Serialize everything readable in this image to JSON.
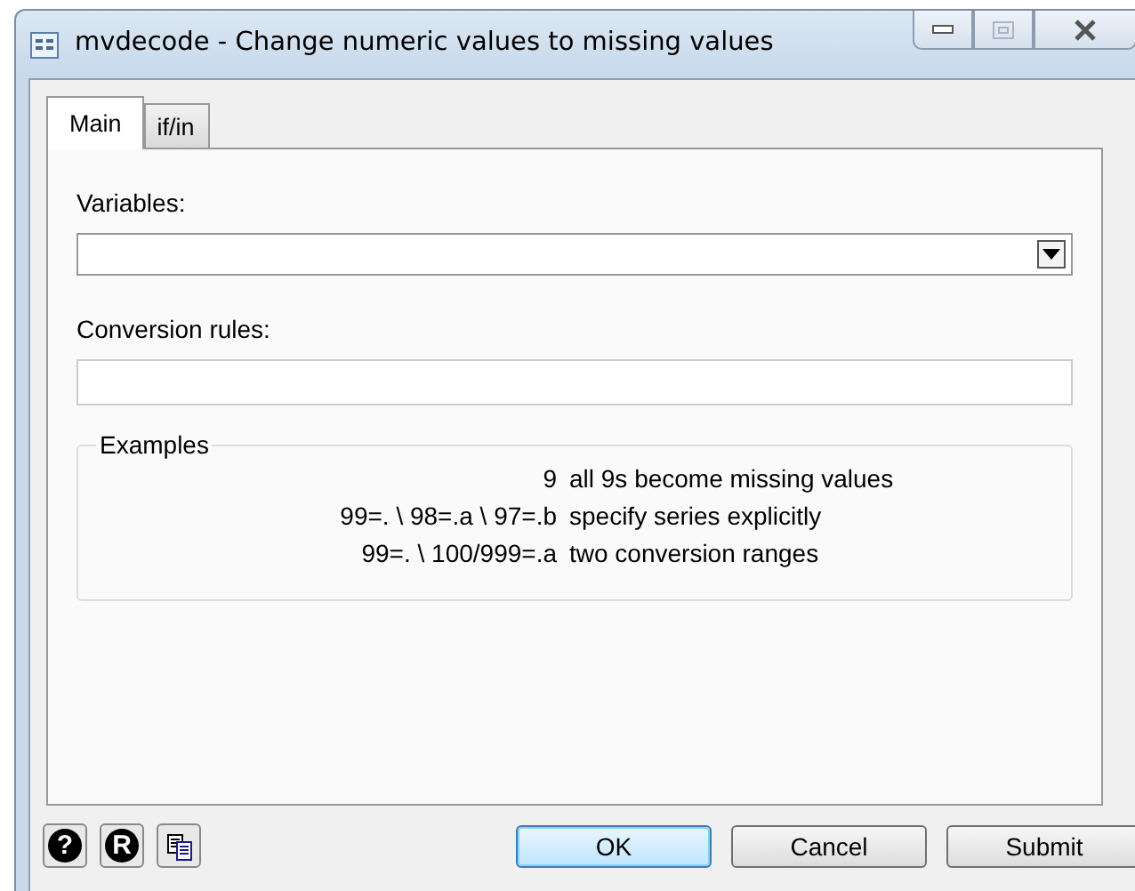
{
  "window": {
    "title": "mvdecode - Change numeric values to missing values",
    "maximize_disabled": true
  },
  "tabs": [
    {
      "label": "Main",
      "selected": true
    },
    {
      "label": "if/in",
      "selected": false
    }
  ],
  "variables": {
    "label": "Variables:"
  },
  "conversion_rules": {
    "label": "Conversion rules:"
  },
  "examples": {
    "title": "Examples",
    "rows": [
      {
        "rule": "9",
        "description": "all 9s become missing values"
      },
      {
        "rule": "99=. \\ 98=.a \\ 97=.b",
        "description": "specify series explicitly"
      },
      {
        "rule": "99=. \\ 100/999=.a",
        "description": "two conversion ranges"
      }
    ]
  },
  "footer_icons": [
    {
      "kind": "help",
      "glyph": "?"
    },
    {
      "kind": "reset",
      "glyph": "R"
    },
    {
      "kind": "copy"
    }
  ],
  "buttons": [
    {
      "label": "OK",
      "default": true
    },
    {
      "label": "Cancel",
      "default": false
    },
    {
      "label": "Submit",
      "default": false
    }
  ]
}
